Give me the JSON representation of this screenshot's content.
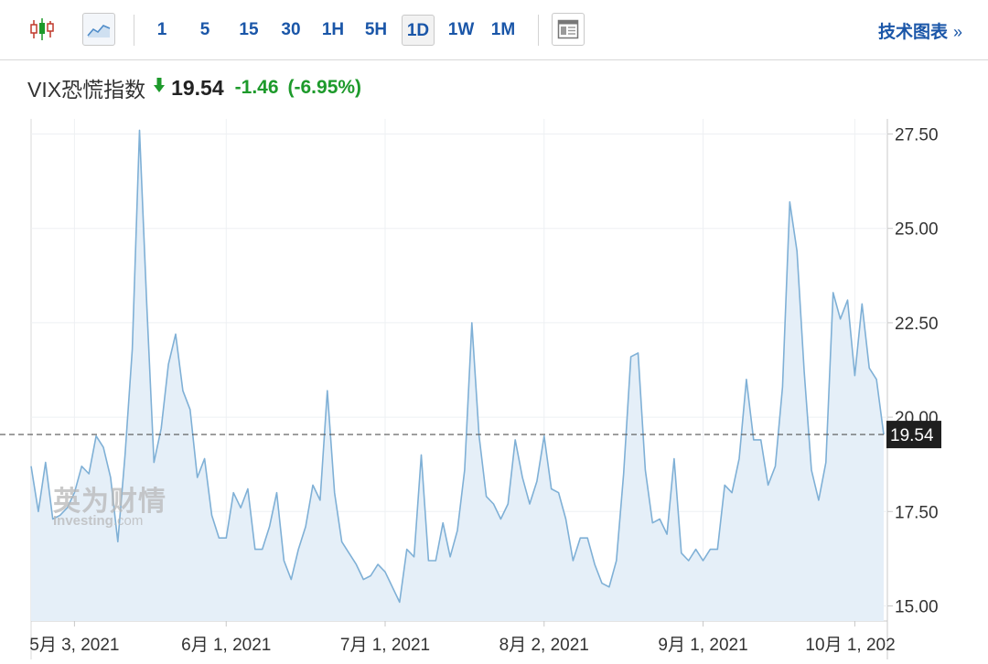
{
  "toolbar": {
    "chart_type_candles": "candlestick-icon",
    "chart_type_area": "area-chart-icon",
    "intervals": [
      "1",
      "5",
      "15",
      "30",
      "1H",
      "5H",
      "1D",
      "1W",
      "1M"
    ],
    "active_interval": "1D",
    "layout_icon": "layout-icon",
    "tech_chart_label": "技术图表",
    "tech_chart_chevron": "»"
  },
  "quote": {
    "title": "VIX恐慌指数",
    "direction_icon": "down-arrow-icon",
    "price": "19.54",
    "change": "-1.46",
    "change_pct": "(-6.95%)"
  },
  "watermark": {
    "cn": "英为财情",
    "en_prefix": "Investing",
    "en_suffix": ".com"
  },
  "colors": {
    "accent": "#1a56a8",
    "down": "#1d9a2b",
    "line": "#7fb0d6",
    "fill": "#e5eff8"
  },
  "chart_data": {
    "type": "area",
    "current_value": 19.54,
    "current_label": "19.54",
    "ylim": [
      14.6,
      27.9
    ],
    "yticks": [
      15.0,
      17.5,
      20.0,
      22.5,
      25.0,
      27.5
    ],
    "ytick_labels": [
      "15.00",
      "17.50",
      "20.00",
      "22.50",
      "25.00",
      "27.50"
    ],
    "xtick_labels": [
      "5月 3, 2021",
      "6月 1, 2021",
      "7月 1, 2021",
      "8月 2, 2021",
      "9月 1, 2021",
      "10月 1, 202"
    ],
    "xtick_index": [
      6,
      27,
      49,
      71,
      93,
      114
    ],
    "values": [
      18.7,
      17.5,
      18.8,
      17.3,
      17.4,
      17.6,
      18.0,
      18.7,
      18.5,
      19.5,
      19.2,
      18.4,
      16.7,
      19.0,
      21.8,
      27.6,
      23.0,
      18.8,
      19.7,
      21.4,
      22.2,
      20.7,
      20.2,
      18.4,
      18.9,
      17.4,
      16.8,
      16.8,
      18.0,
      17.6,
      18.1,
      16.5,
      16.5,
      17.1,
      18.0,
      16.2,
      15.7,
      16.5,
      17.1,
      18.2,
      17.8,
      20.7,
      18.0,
      16.7,
      16.4,
      16.1,
      15.7,
      15.8,
      16.1,
      15.9,
      15.5,
      15.1,
      16.5,
      16.3,
      19.0,
      16.2,
      16.2,
      17.2,
      16.3,
      17.0,
      18.6,
      22.5,
      19.5,
      17.9,
      17.7,
      17.3,
      17.7,
      19.4,
      18.4,
      17.7,
      18.3,
      19.5,
      18.1,
      18.0,
      17.3,
      16.2,
      16.8,
      16.8,
      16.1,
      15.6,
      15.5,
      16.2,
      18.5,
      21.6,
      21.7,
      18.6,
      17.2,
      17.3,
      16.9,
      18.9,
      16.4,
      16.2,
      16.5,
      16.2,
      16.5,
      16.5,
      18.2,
      18.0,
      18.9,
      21.0,
      19.4,
      19.4,
      18.2,
      18.7,
      20.8,
      25.7,
      24.4,
      21.2,
      18.6,
      17.8,
      18.8,
      23.3,
      22.6,
      23.1,
      21.1,
      23.0,
      21.3,
      21.0,
      19.54
    ]
  }
}
